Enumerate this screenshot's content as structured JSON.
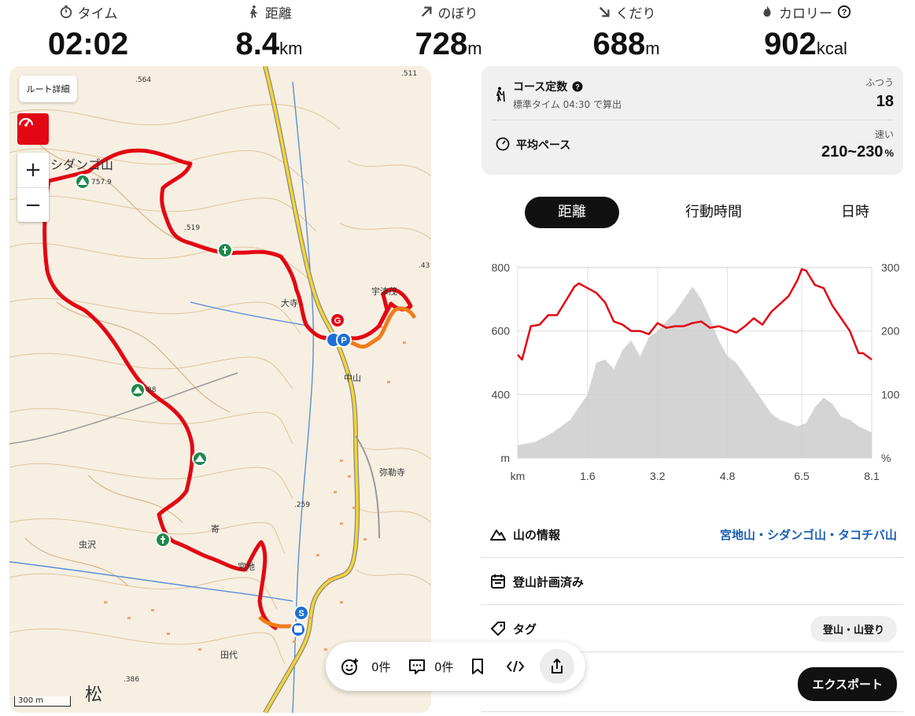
{
  "stats": [
    {
      "label": "タイム",
      "value": "02:02",
      "unit": "",
      "icon": "stopwatch-icon"
    },
    {
      "label": "距離",
      "value": "8.4",
      "unit": "km",
      "icon": "walker-icon"
    },
    {
      "label": "のぼり",
      "value": "728",
      "unit": "m",
      "icon": "arrow-up-right-icon"
    },
    {
      "label": "くだり",
      "value": "688",
      "unit": "m",
      "icon": "arrow-down-right-icon"
    },
    {
      "label": "カロリー",
      "value": "902",
      "unit": "kcal",
      "icon": "flame-icon"
    }
  ],
  "map": {
    "route_detail_label": "ルート詳細",
    "zoom_in": "+",
    "zoom_out": "−",
    "scale_label": "300 m",
    "labels": [
      "シダンゴ山",
      "757.9",
      ".564",
      ".519",
      ".511",
      ".43",
      ".259",
      ".386",
      "88",
      "大寺",
      "宇津茂",
      "中山",
      "弥勒寺",
      "寄",
      "宮地",
      "田代",
      "虫沢",
      "松"
    ]
  },
  "summary": {
    "course_title": "コース定数",
    "course_sub": "標準タイム 04:30 で算出",
    "course_level": "ふつう",
    "course_value": "18",
    "pace_title": "平均ペース",
    "pace_level": "速い",
    "pace_value": "210~230",
    "pace_unit": "%"
  },
  "tabs": [
    {
      "label": "距離",
      "active": true
    },
    {
      "label": "行動時間",
      "active": false
    },
    {
      "label": "日時",
      "active": false
    }
  ],
  "chart_data": {
    "type": "line",
    "x_unit": "km",
    "x_ticks": [
      "km",
      "1.6",
      "3.2",
      "4.8",
      "6.5",
      "8.1"
    ],
    "y_left_unit": "m",
    "y_left_ticks": [
      "800",
      "600",
      "400",
      "m"
    ],
    "y_left_lim": [
      200,
      800
    ],
    "y_right_unit": "%",
    "y_right_ticks": [
      "300",
      "200",
      "100",
      "%"
    ],
    "y_right_lim": [
      0,
      300
    ],
    "x_lim": [
      0,
      8.1
    ],
    "series": [
      {
        "axis": "left",
        "color": "#e30613",
        "x": [
          0,
          0.1,
          0.3,
          0.5,
          0.7,
          0.9,
          1.1,
          1.3,
          1.4,
          1.6,
          1.8,
          2.0,
          2.2,
          2.4,
          2.6,
          2.8,
          3.0,
          3.2,
          3.4,
          3.6,
          3.8,
          4.0,
          4.2,
          4.4,
          4.6,
          4.8,
          5.0,
          5.2,
          5.4,
          5.6,
          5.8,
          6.0,
          6.2,
          6.4,
          6.5,
          6.6,
          6.8,
          7.0,
          7.2,
          7.4,
          7.6,
          7.8,
          7.9,
          8.1
        ],
        "y": [
          525,
          510,
          615,
          620,
          650,
          650,
          695,
          740,
          750,
          735,
          720,
          690,
          630,
          620,
          600,
          600,
          590,
          625,
          610,
          615,
          615,
          625,
          630,
          610,
          615,
          605,
          595,
          615,
          640,
          620,
          660,
          685,
          710,
          760,
          795,
          790,
          745,
          735,
          680,
          640,
          600,
          530,
          530,
          510
        ]
      },
      {
        "axis": "right",
        "color": "#cccccc",
        "x": [
          0,
          0.4,
          0.8,
          1.2,
          1.6,
          1.8,
          2.0,
          2.2,
          2.4,
          2.6,
          2.8,
          3.0,
          3.2,
          3.4,
          3.6,
          3.8,
          4.0,
          4.2,
          4.4,
          4.6,
          4.8,
          5.0,
          5.2,
          5.4,
          5.6,
          5.8,
          6.0,
          6.2,
          6.4,
          6.6,
          6.8,
          7.0,
          7.2,
          7.4,
          7.6,
          7.8,
          8.1
        ],
        "y": [
          20,
          25,
          40,
          60,
          100,
          150,
          155,
          140,
          170,
          185,
          160,
          190,
          200,
          215,
          230,
          250,
          270,
          250,
          220,
          185,
          160,
          150,
          130,
          110,
          90,
          70,
          60,
          55,
          50,
          55,
          80,
          95,
          85,
          65,
          60,
          50,
          40
        ]
      }
    ]
  },
  "info_rows": [
    {
      "label": "山の情報",
      "value": "宮地山・シダンゴ山・タコチバ山"
    },
    {
      "label": "登山計画済み",
      "value": ""
    },
    {
      "label": "タグ",
      "value": "登山・山登り"
    },
    {
      "label": "",
      "value": "エクスポート"
    }
  ],
  "toolbar": {
    "likes": "0件",
    "comments": "0件"
  }
}
